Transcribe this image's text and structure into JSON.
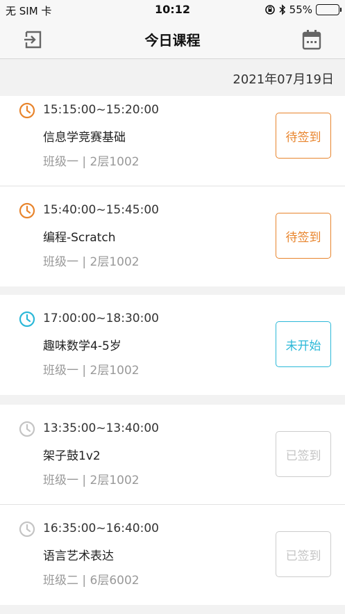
{
  "status_bar": {
    "carrier": "无 SIM 卡",
    "time": "10:12",
    "battery": "55%",
    "battery_level": 0.55
  },
  "header": {
    "title": "今日课程",
    "left_icon": "exit-icon",
    "right_icon": "calendar-icon"
  },
  "date": "2021年07月19日",
  "colors": {
    "pending": "#e8842c",
    "not_started": "#2bb8d8",
    "done": "#c4c4c4"
  },
  "groups": [
    {
      "courses": [
        {
          "time": "15:15:00~15:20:00",
          "name": "信息学竞赛基础",
          "location": "班级一 | 2层1002",
          "status": "待签到",
          "state": "pending"
        },
        {
          "time": "15:40:00~15:45:00",
          "name": "编程-Scratch",
          "location": "班级一 | 2层1002",
          "status": "待签到",
          "state": "pending"
        }
      ]
    },
    {
      "courses": [
        {
          "time": "17:00:00~18:30:00",
          "name": "趣味数学4-5岁",
          "location": "班级一 | 2层1002",
          "status": "未开始",
          "state": "notstarted"
        }
      ]
    },
    {
      "courses": [
        {
          "time": "13:35:00~13:40:00",
          "name": "架子鼓1v2",
          "location": "班级一 | 2层1002",
          "status": "已签到",
          "state": "done"
        },
        {
          "time": "16:35:00~16:40:00",
          "name": "语言艺术表达",
          "location": "班级二 | 6层6002",
          "status": "已签到",
          "state": "done"
        }
      ]
    }
  ]
}
